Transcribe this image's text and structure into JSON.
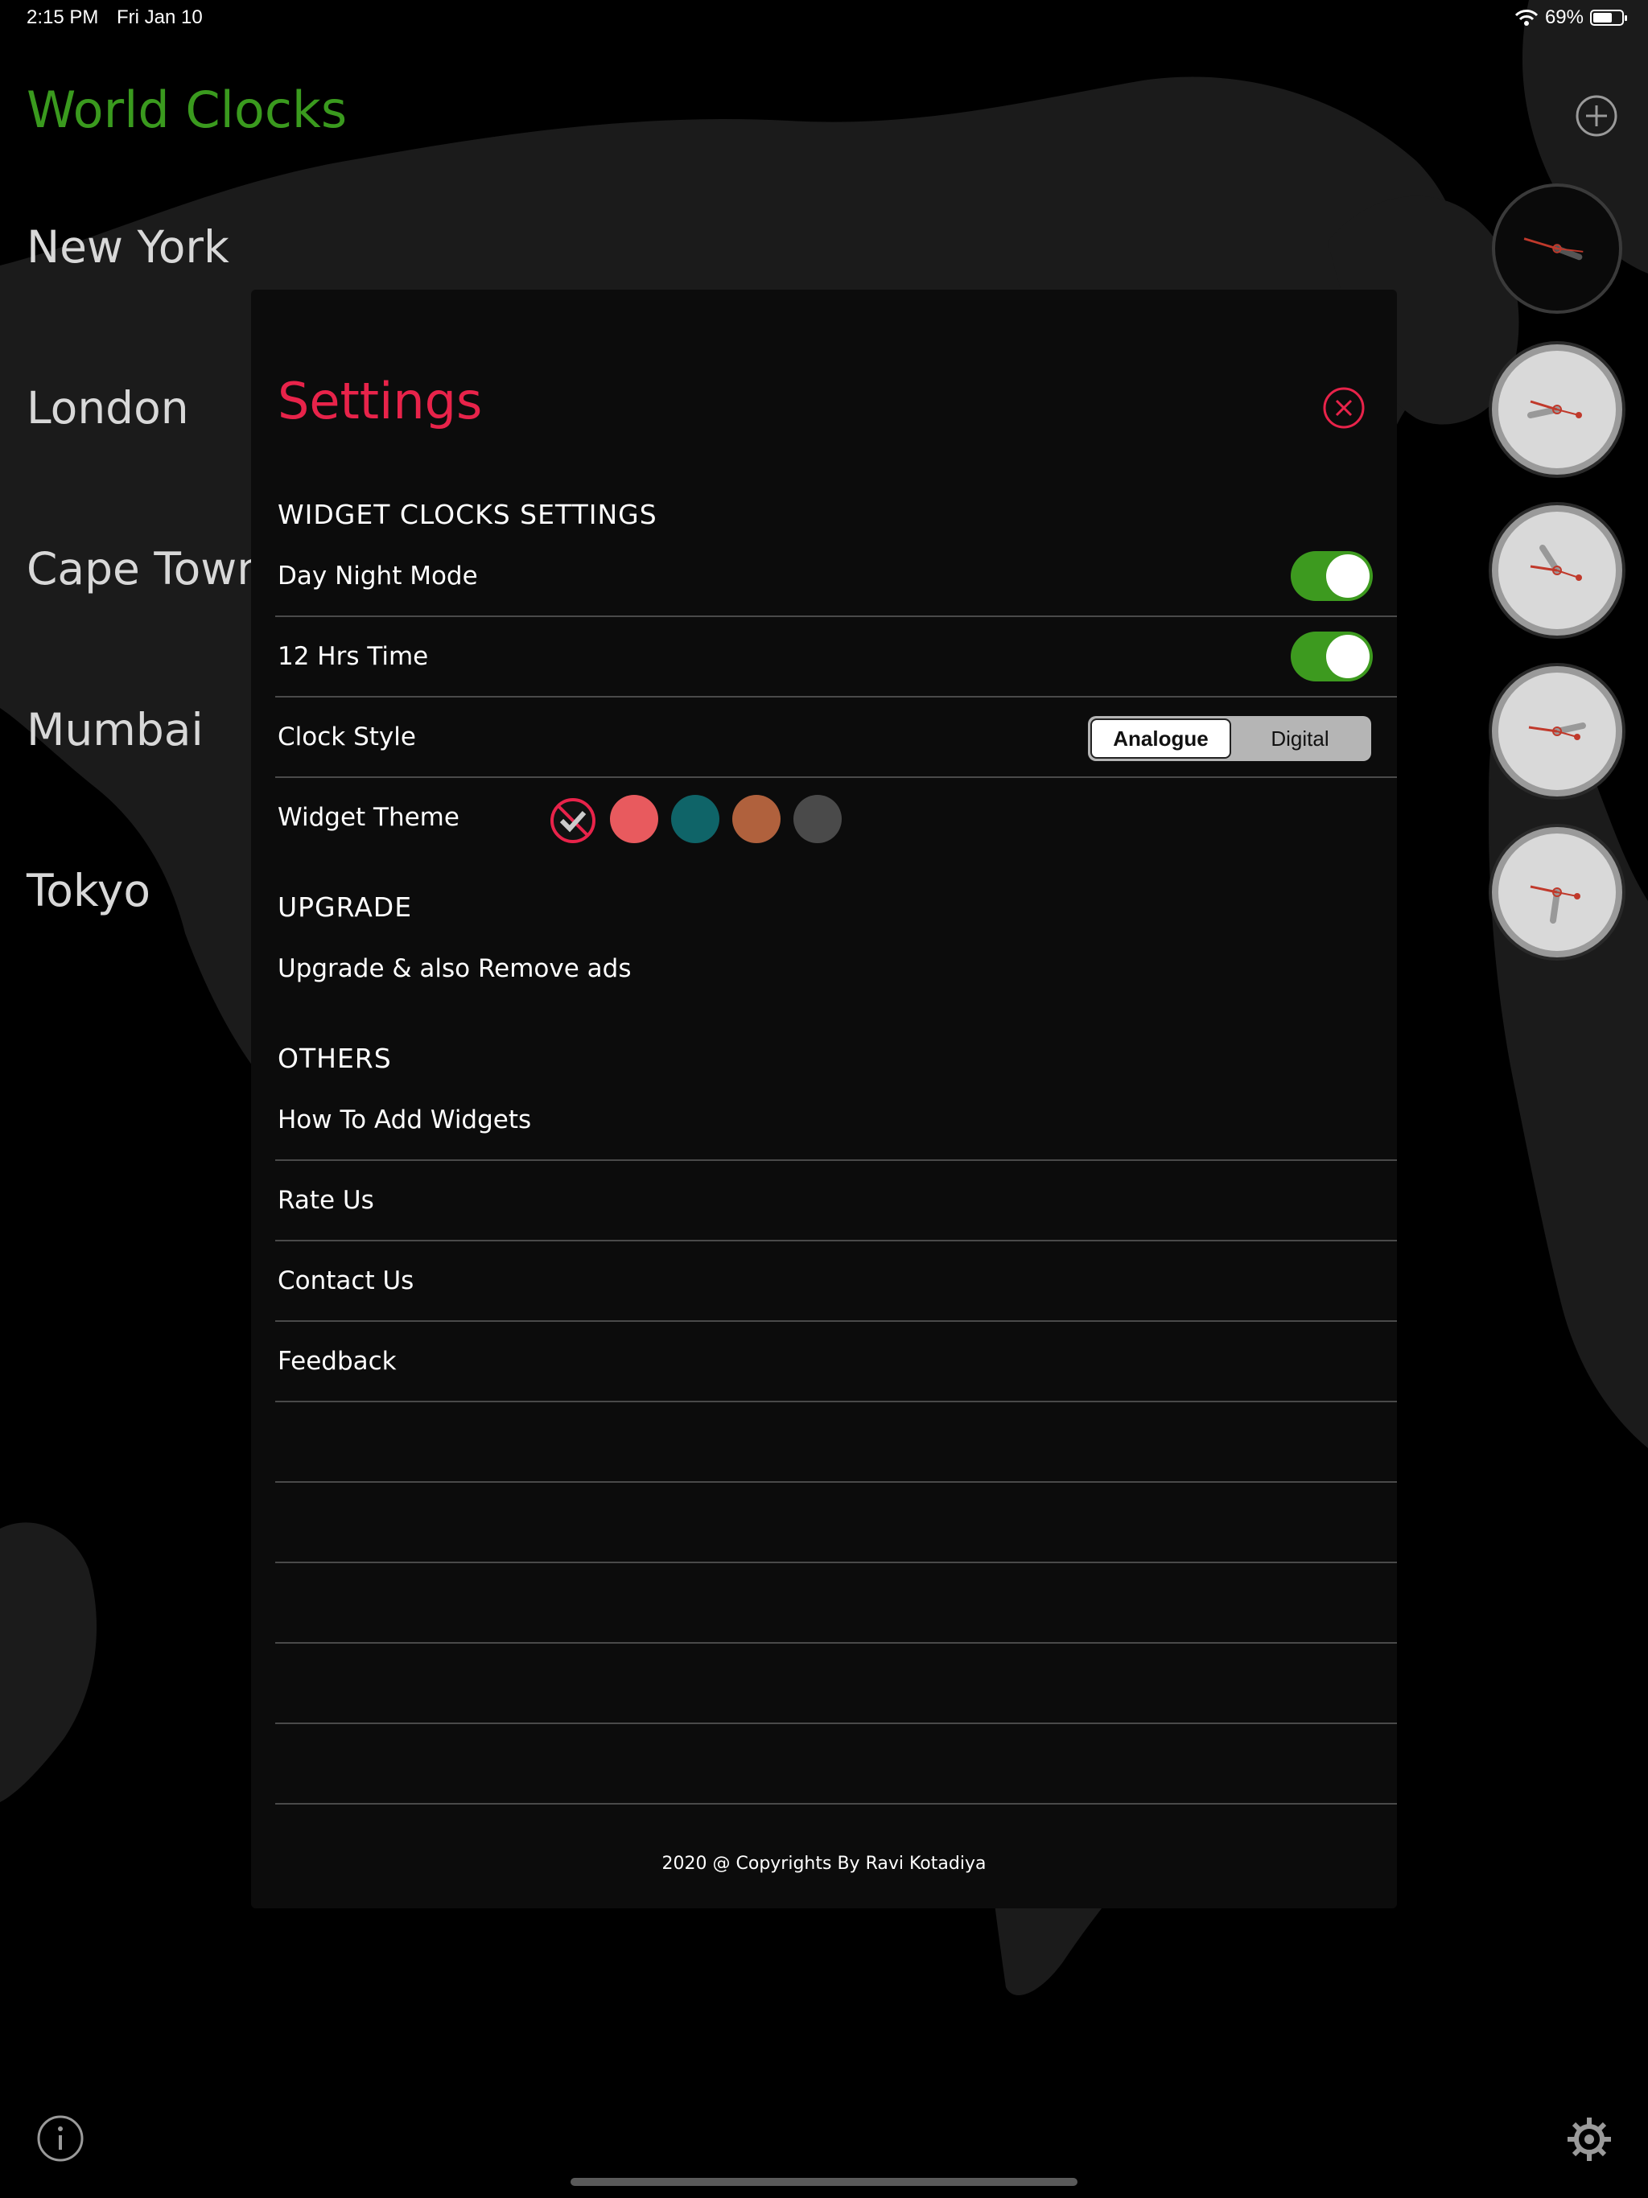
{
  "status_bar": {
    "time": "2:15 PM",
    "date": "Fri Jan 10",
    "battery_text": "69%",
    "battery_level": 0.69
  },
  "app": {
    "title": "World Clocks"
  },
  "cities": [
    "New York",
    "London",
    "Cape Town",
    "Mumbai",
    "Tokyo"
  ],
  "settings": {
    "title": "Settings",
    "widget_section": "WIDGET CLOCKS SETTINGS",
    "day_night_mode": {
      "label": "Day Night Mode",
      "on": true
    },
    "hrs_time": {
      "label": "12 Hrs Time",
      "on": true
    },
    "clock_style": {
      "label": "Clock Style",
      "options": [
        "Analogue",
        "Digital"
      ],
      "selected": "Analogue"
    },
    "widget_theme": {
      "label": "Widget Theme",
      "colors": [
        "#e85a5e",
        "#0f6468",
        "#b0613d",
        "#4a4a4a"
      ],
      "selected": "none"
    },
    "upgrade_section": "UPGRADE",
    "upgrade_item": "Upgrade & also Remove ads",
    "others_section": "OTHERS",
    "others_items": [
      "How To Add Widgets",
      "Rate Us",
      "Contact Us",
      "Feedback"
    ],
    "copyright": "2020 @ Copyrights By Ravi Kotadiya"
  },
  "colors": {
    "accent_green": "#3a9a1e",
    "accent_red": "#e8234a"
  },
  "icons": [
    "wifi-icon",
    "battery-icon",
    "plus-circle-icon",
    "close-circle-icon",
    "info-icon",
    "gear-icon"
  ]
}
